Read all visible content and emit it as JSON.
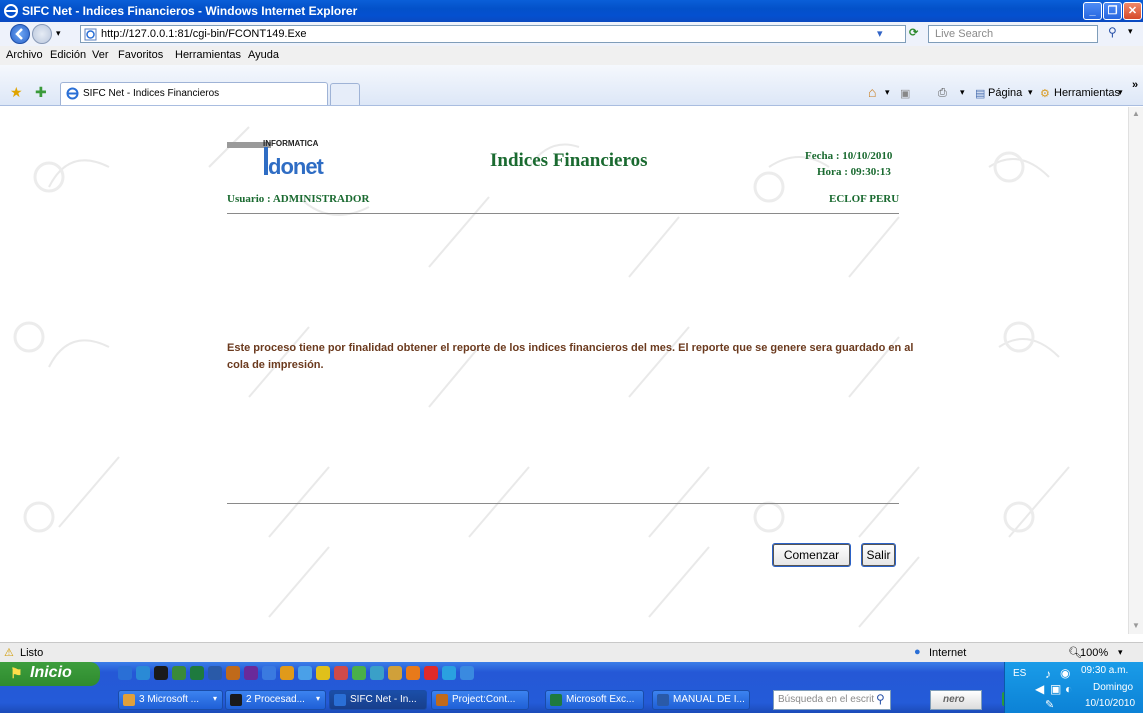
{
  "window": {
    "title": "SIFC Net - Indices Financieros - Windows Internet Explorer"
  },
  "address": {
    "url": "http://127.0.0.1:81/cgi-bin/FCONT149.Exe",
    "search_placeholder": "Live Search"
  },
  "menu": [
    "Archivo",
    "Edición",
    "Ver",
    "Favoritos",
    "Herramientas",
    "Ayuda"
  ],
  "tab": {
    "label": "SIFC Net - Indices Financieros"
  },
  "toolbar": {
    "page": "Página",
    "tools": "Herramientas"
  },
  "page": {
    "logo_text": "INFORMATICA",
    "logo_word": "donet",
    "title": "Indices Financieros",
    "fecha": "Fecha : 10/10/2010",
    "hora": "Hora : 09:30:13",
    "usuario": "Usuario :  ADMINISTRADOR",
    "org": "ECLOF PERU",
    "description": "Este proceso tiene por finalidad obtener el reporte de los indices financieros del mes. El reporte que se genere sera guardado en al cola de impresión.",
    "btn_start": "Comenzar",
    "btn_exit": "Salir"
  },
  "status": {
    "text": "Listo",
    "zone": "Internet",
    "zoom": "100%"
  },
  "taskbar": {
    "start": "Inicio",
    "items": [
      "3 Microsoft ...",
      "2 Procesad...",
      "SIFC Net - In...",
      "Project:Cont...",
      "Microsoft Exc...",
      "MANUAL DE I..."
    ],
    "search_placeholder": "Búsqueda en el escrit",
    "lang": "ES",
    "time": "09:30 a.m.",
    "day": "Domingo",
    "date": "10/10/2010"
  }
}
